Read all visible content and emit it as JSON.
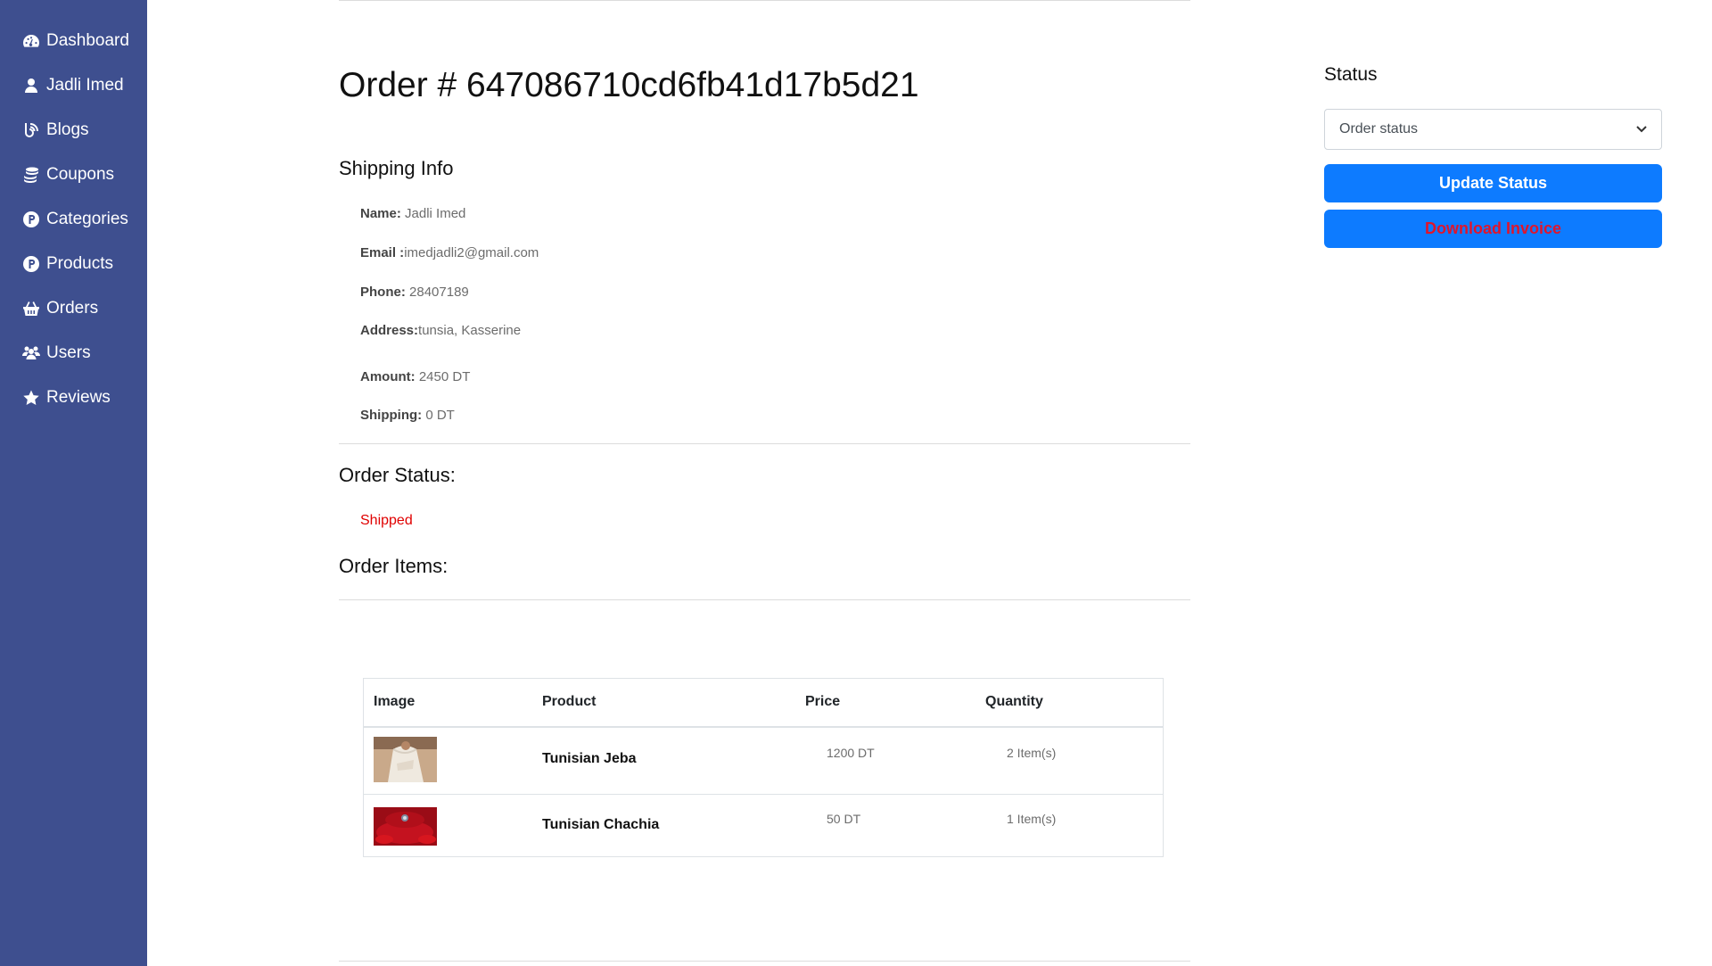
{
  "sidebar": {
    "items": [
      {
        "label": "Dashboard",
        "icon": "dashboard-icon"
      },
      {
        "label": "Jadli Imed",
        "icon": "user-icon"
      },
      {
        "label": "Blogs",
        "icon": "blog-icon"
      },
      {
        "label": "Coupons",
        "icon": "coins-icon"
      },
      {
        "label": "Categories",
        "icon": "product-hunt-icon"
      },
      {
        "label": "Products",
        "icon": "product-hunt-icon"
      },
      {
        "label": "Orders",
        "icon": "basket-icon"
      },
      {
        "label": "Users",
        "icon": "users-icon"
      },
      {
        "label": "Reviews",
        "icon": "star-icon"
      }
    ]
  },
  "order": {
    "title": "Order # 647086710cd6fb41d17b5d21",
    "shipping_heading": "Shipping Info",
    "name_label": "Name:",
    "name_value": " Jadli Imed",
    "email_label": "Email :",
    "email_value": "imedjadli2@gmail.com",
    "phone_label": "Phone:",
    "phone_value": " 28407189",
    "address_label": "Address:",
    "address_value": "tunsia, Kasserine",
    "amount_label": "Amount:",
    "amount_value": " 2450 DT",
    "shipping_label": "Shipping:",
    "shipping_value": " 0 DT",
    "status_heading": "Order Status:",
    "status_value": "Shipped",
    "items_heading": "Order Items:"
  },
  "items_table": {
    "headers": [
      "Image",
      "Product",
      "Price",
      "Quantity"
    ],
    "rows": [
      {
        "product": "Tunisian Jeba",
        "price": "1200 DT",
        "quantity": "2 Item(s)"
      },
      {
        "product": "Tunisian Chachia",
        "price": "50 DT",
        "quantity": "1 Item(s)"
      }
    ]
  },
  "status_panel": {
    "label": "Status",
    "select_value": "Order status",
    "update_button": "Update Status",
    "download_button": "Download Invoice"
  },
  "colors": {
    "sidebar": "#3e4f8f",
    "primary_button": "#0d7bff",
    "shipped": "#e00000",
    "invoice_text": "#e0152c"
  }
}
